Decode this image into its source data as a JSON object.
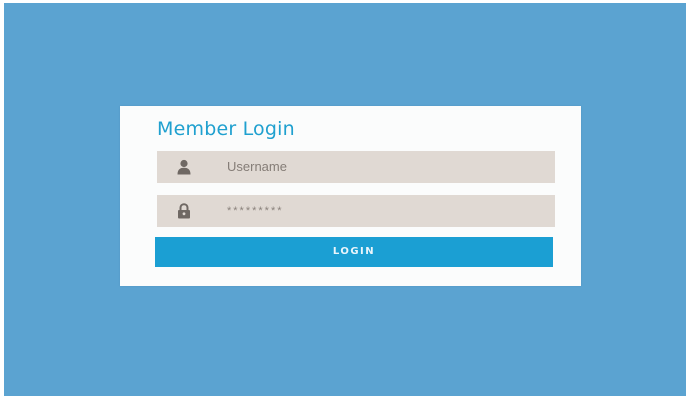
{
  "login": {
    "title": "Member Login",
    "username": {
      "placeholder": "Username",
      "icon": "user-icon"
    },
    "password": {
      "value_masked": "*********",
      "icon": "lock-icon"
    },
    "button_label": "LOGIN"
  },
  "colors": {
    "background": "#5ba3d1",
    "card": "#fbfcfc",
    "title": "#1fa0cf",
    "field": "#e0d9d3",
    "button": "#1b9fd3"
  }
}
